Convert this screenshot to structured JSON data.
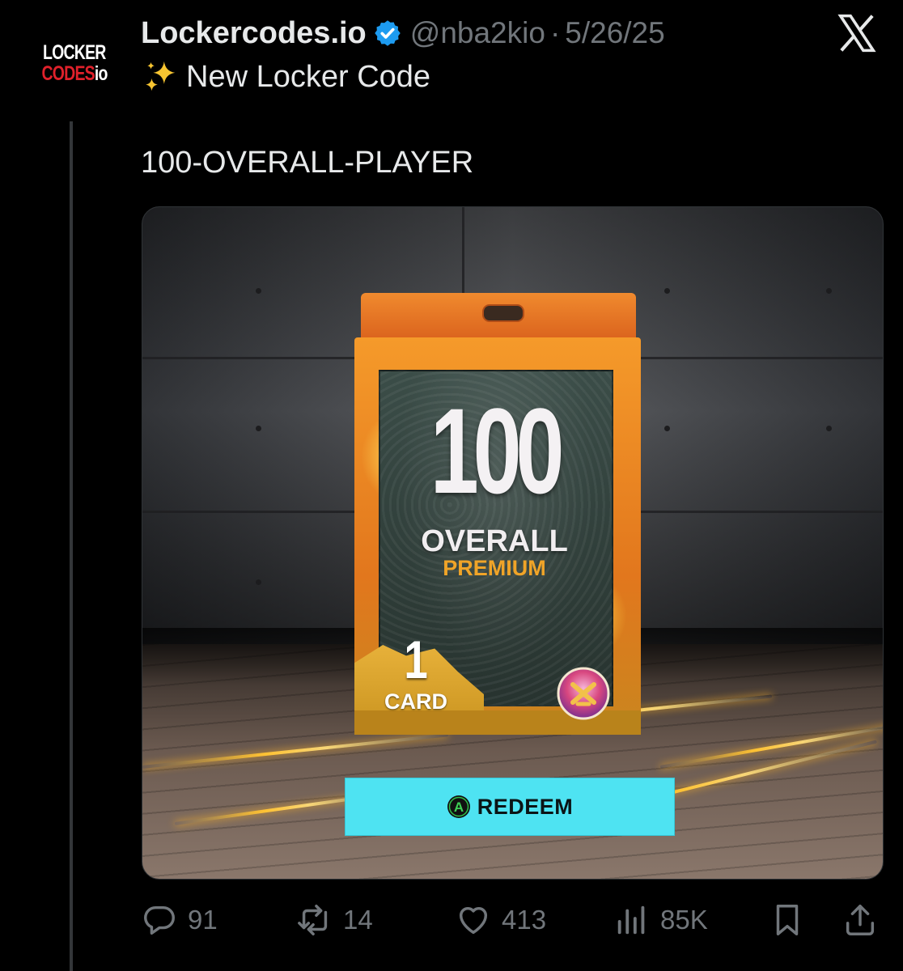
{
  "avatar": {
    "line1": "LOCKER",
    "line2_red": "CODES",
    "line2_io": "io"
  },
  "header": {
    "name": "Lockercodes.io",
    "verified": true,
    "handle": "@nba2kio",
    "separator": "·",
    "date": "5/26/25"
  },
  "icons": {
    "verified": "verified-badge-icon",
    "x_logo": "x-logo-icon",
    "sparkles": "sparkles-icon",
    "reply": "reply-icon",
    "retweet": "retweet-icon",
    "like": "heart-icon",
    "views": "views-icon",
    "bookmark": "bookmark-icon",
    "share": "share-icon"
  },
  "tweet": {
    "line1_emoji": "✨",
    "line1": "New Locker Code",
    "code": "100-OVERALL-PLAYER"
  },
  "media": {
    "pack_number": "100",
    "pack_overall": "OVERALL",
    "pack_premium": "PREMIUM",
    "pack_count": "1",
    "pack_count_label": "CARD",
    "redeem_button_icon_letter": "A",
    "redeem_label": "REDEEM"
  },
  "actions": {
    "replies": "91",
    "retweets": "14",
    "likes": "413",
    "views": "85K"
  },
  "colors": {
    "background": "#000000",
    "text": "#e7e9ea",
    "muted": "#71767b",
    "verified": "#1d9bf0",
    "redeem_bg": "#4ee3f2",
    "brand_red": "#e0212b",
    "pack_orange": "#f08a2e"
  }
}
